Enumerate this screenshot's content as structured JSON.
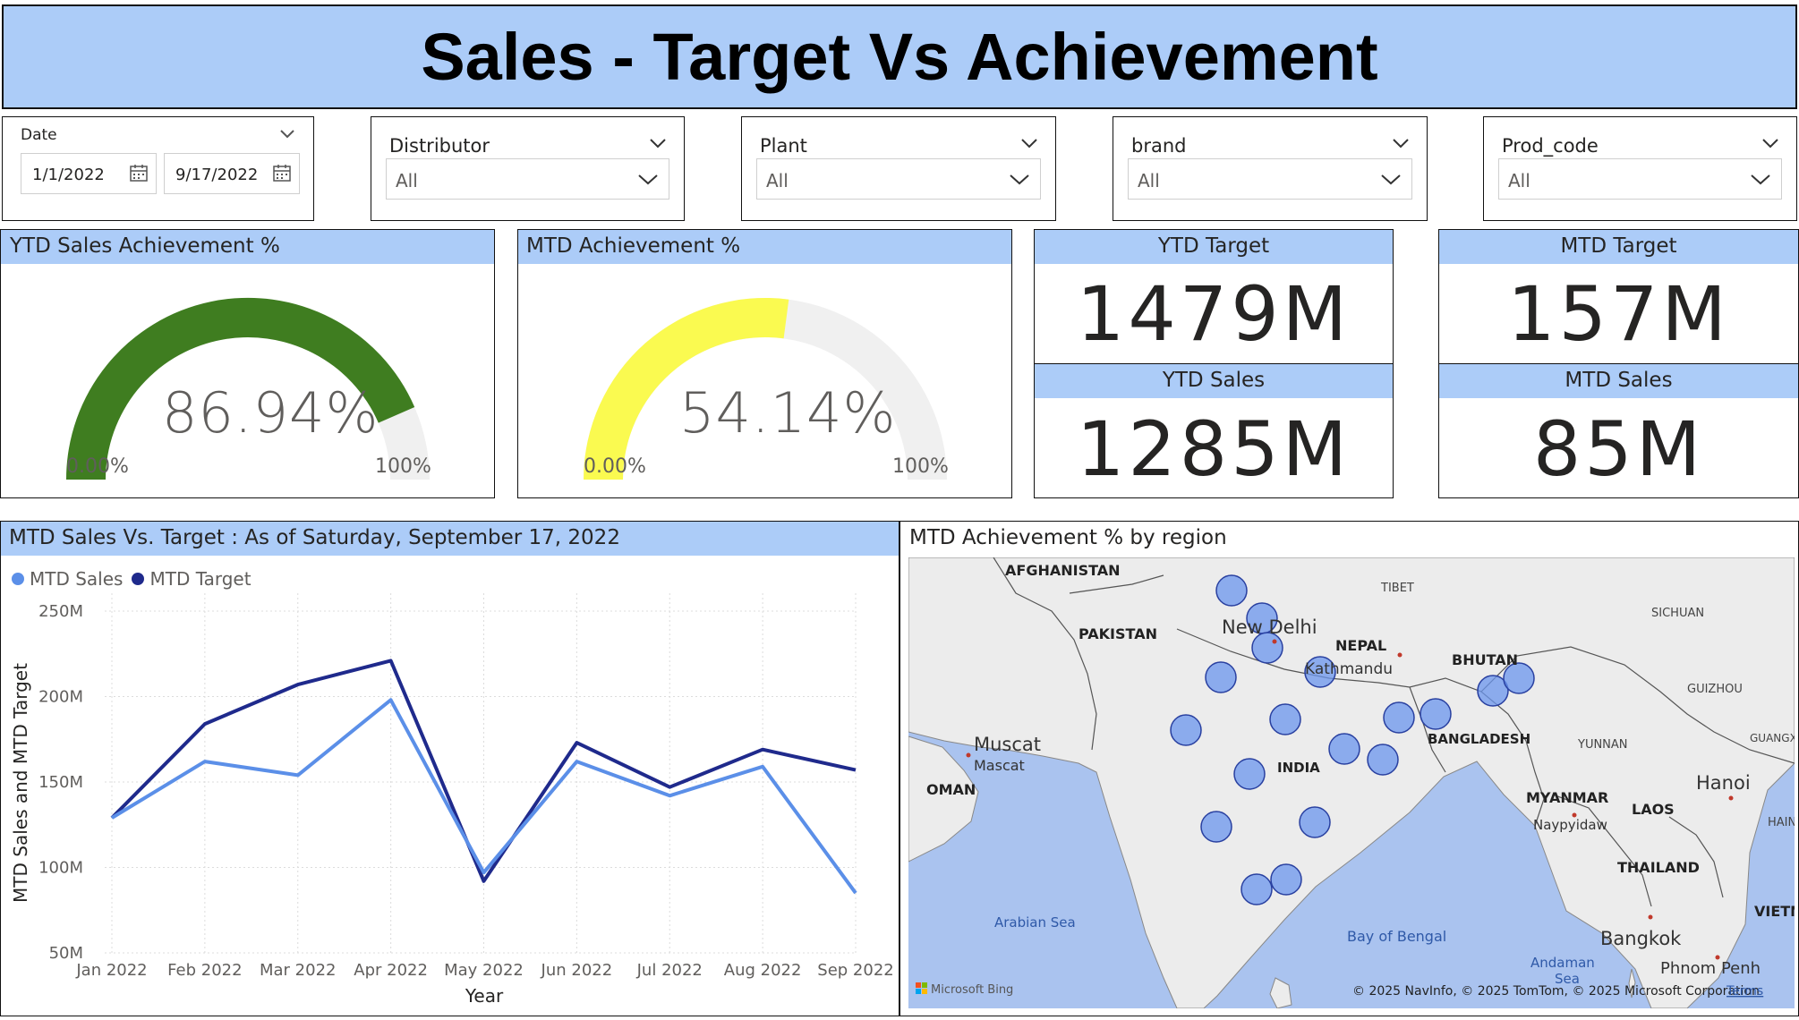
{
  "title": "Sales - Target Vs Achievement",
  "slicers": {
    "date": {
      "label": "Date",
      "start": "1/1/2022",
      "end": "9/17/2022"
    },
    "distributor": {
      "label": "Distributor",
      "value": "All"
    },
    "plant": {
      "label": "Plant",
      "value": "All"
    },
    "brand": {
      "label": "brand",
      "value": "All"
    },
    "prod_code": {
      "label": "Prod_code",
      "value": "All"
    }
  },
  "gauges": {
    "ytd": {
      "title": "YTD Sales Achievement %",
      "value_text": "86.94%",
      "value": 0.8694,
      "min": "0.00%",
      "max": "100%",
      "color": "#3f7d20"
    },
    "mtd": {
      "title": "MTD Achievement %",
      "value_text": "54.14%",
      "value": 0.5414,
      "min": "0.00%",
      "max": "100%",
      "color": "#fafa50"
    }
  },
  "kpis": {
    "ytd_target": {
      "label": "YTD Target",
      "value": "1479M"
    },
    "ytd_sales": {
      "label": "YTD Sales",
      "value": "1285M"
    },
    "mtd_target": {
      "label": "MTD Target",
      "value": "157M"
    },
    "mtd_sales": {
      "label": "MTD Sales",
      "value": "85M"
    }
  },
  "line_chart": {
    "title": "MTD Sales Vs. Target : As of Saturday, September 17, 2022",
    "legend": [
      {
        "name": "MTD Sales",
        "color": "#5b8fe8"
      },
      {
        "name": "MTD Target",
        "color": "#1f2a8c"
      }
    ]
  },
  "chart_data": {
    "type": "line",
    "categories": [
      "Jan 2022",
      "Feb 2022",
      "Mar 2022",
      "Apr 2022",
      "May 2022",
      "Jun 2022",
      "Jul 2022",
      "Aug 2022",
      "Sep 2022"
    ],
    "series": [
      {
        "name": "MTD Sales",
        "values": [
          129,
          162,
          154,
          198,
          97,
          162,
          142,
          159,
          85
        ],
        "color": "#5b8fe8"
      },
      {
        "name": "MTD Target",
        "values": [
          129,
          184,
          207,
          221,
          92,
          173,
          147,
          169,
          157
        ],
        "color": "#1f2a8c"
      }
    ],
    "yticks": [
      "250M",
      "200M",
      "150M",
      "100M",
      "50M"
    ],
    "ylim": [
      50,
      250
    ],
    "xlabel": "Year",
    "ylabel": "MTD Sales and MTD Target",
    "grid": true
  },
  "map": {
    "title": "MTD Achievement % by region",
    "labels": {
      "afghanistan": "AFGHANISTAN",
      "pakistan": "PAKISTAN",
      "tibet": "TIBET",
      "sichuan": "SICHUAN",
      "new_delhi": "New Delhi",
      "nepal": "NEPAL",
      "kathmandu": "Kathmandu",
      "bhutan": "BHUTAN",
      "guizhou": "GUIZHOU",
      "muscat_big": "Muscat",
      "muscat_small": "Mascat",
      "oman": "OMAN",
      "india": "INDIA",
      "bangladesh": "BANGLADESH",
      "yunnan": "YUNNAN",
      "guangxi": "GUANGX ZHUAN",
      "myanmar": "MYANMAR",
      "naypyidaw": "Naypyidaw",
      "laos": "LAOS",
      "hanoi": "Hanoi",
      "hain": "HAIN",
      "thailand": "THAILAND",
      "arabian_sea": "Arabian Sea",
      "bay_of_bengal": "Bay of Bengal",
      "bangkok": "Bangkok",
      "vietnam": "VIETNA",
      "andaman": "Andaman",
      "sea": "Sea",
      "phnom_penh": "Phnom Penh"
    },
    "attribution": "© 2025 NavInfo, © 2025 TomTom, © 2025 Microsoft Corporation",
    "terms": "Terms",
    "bing": "Microsoft Bing",
    "bubble_color": "#6b95ee"
  }
}
